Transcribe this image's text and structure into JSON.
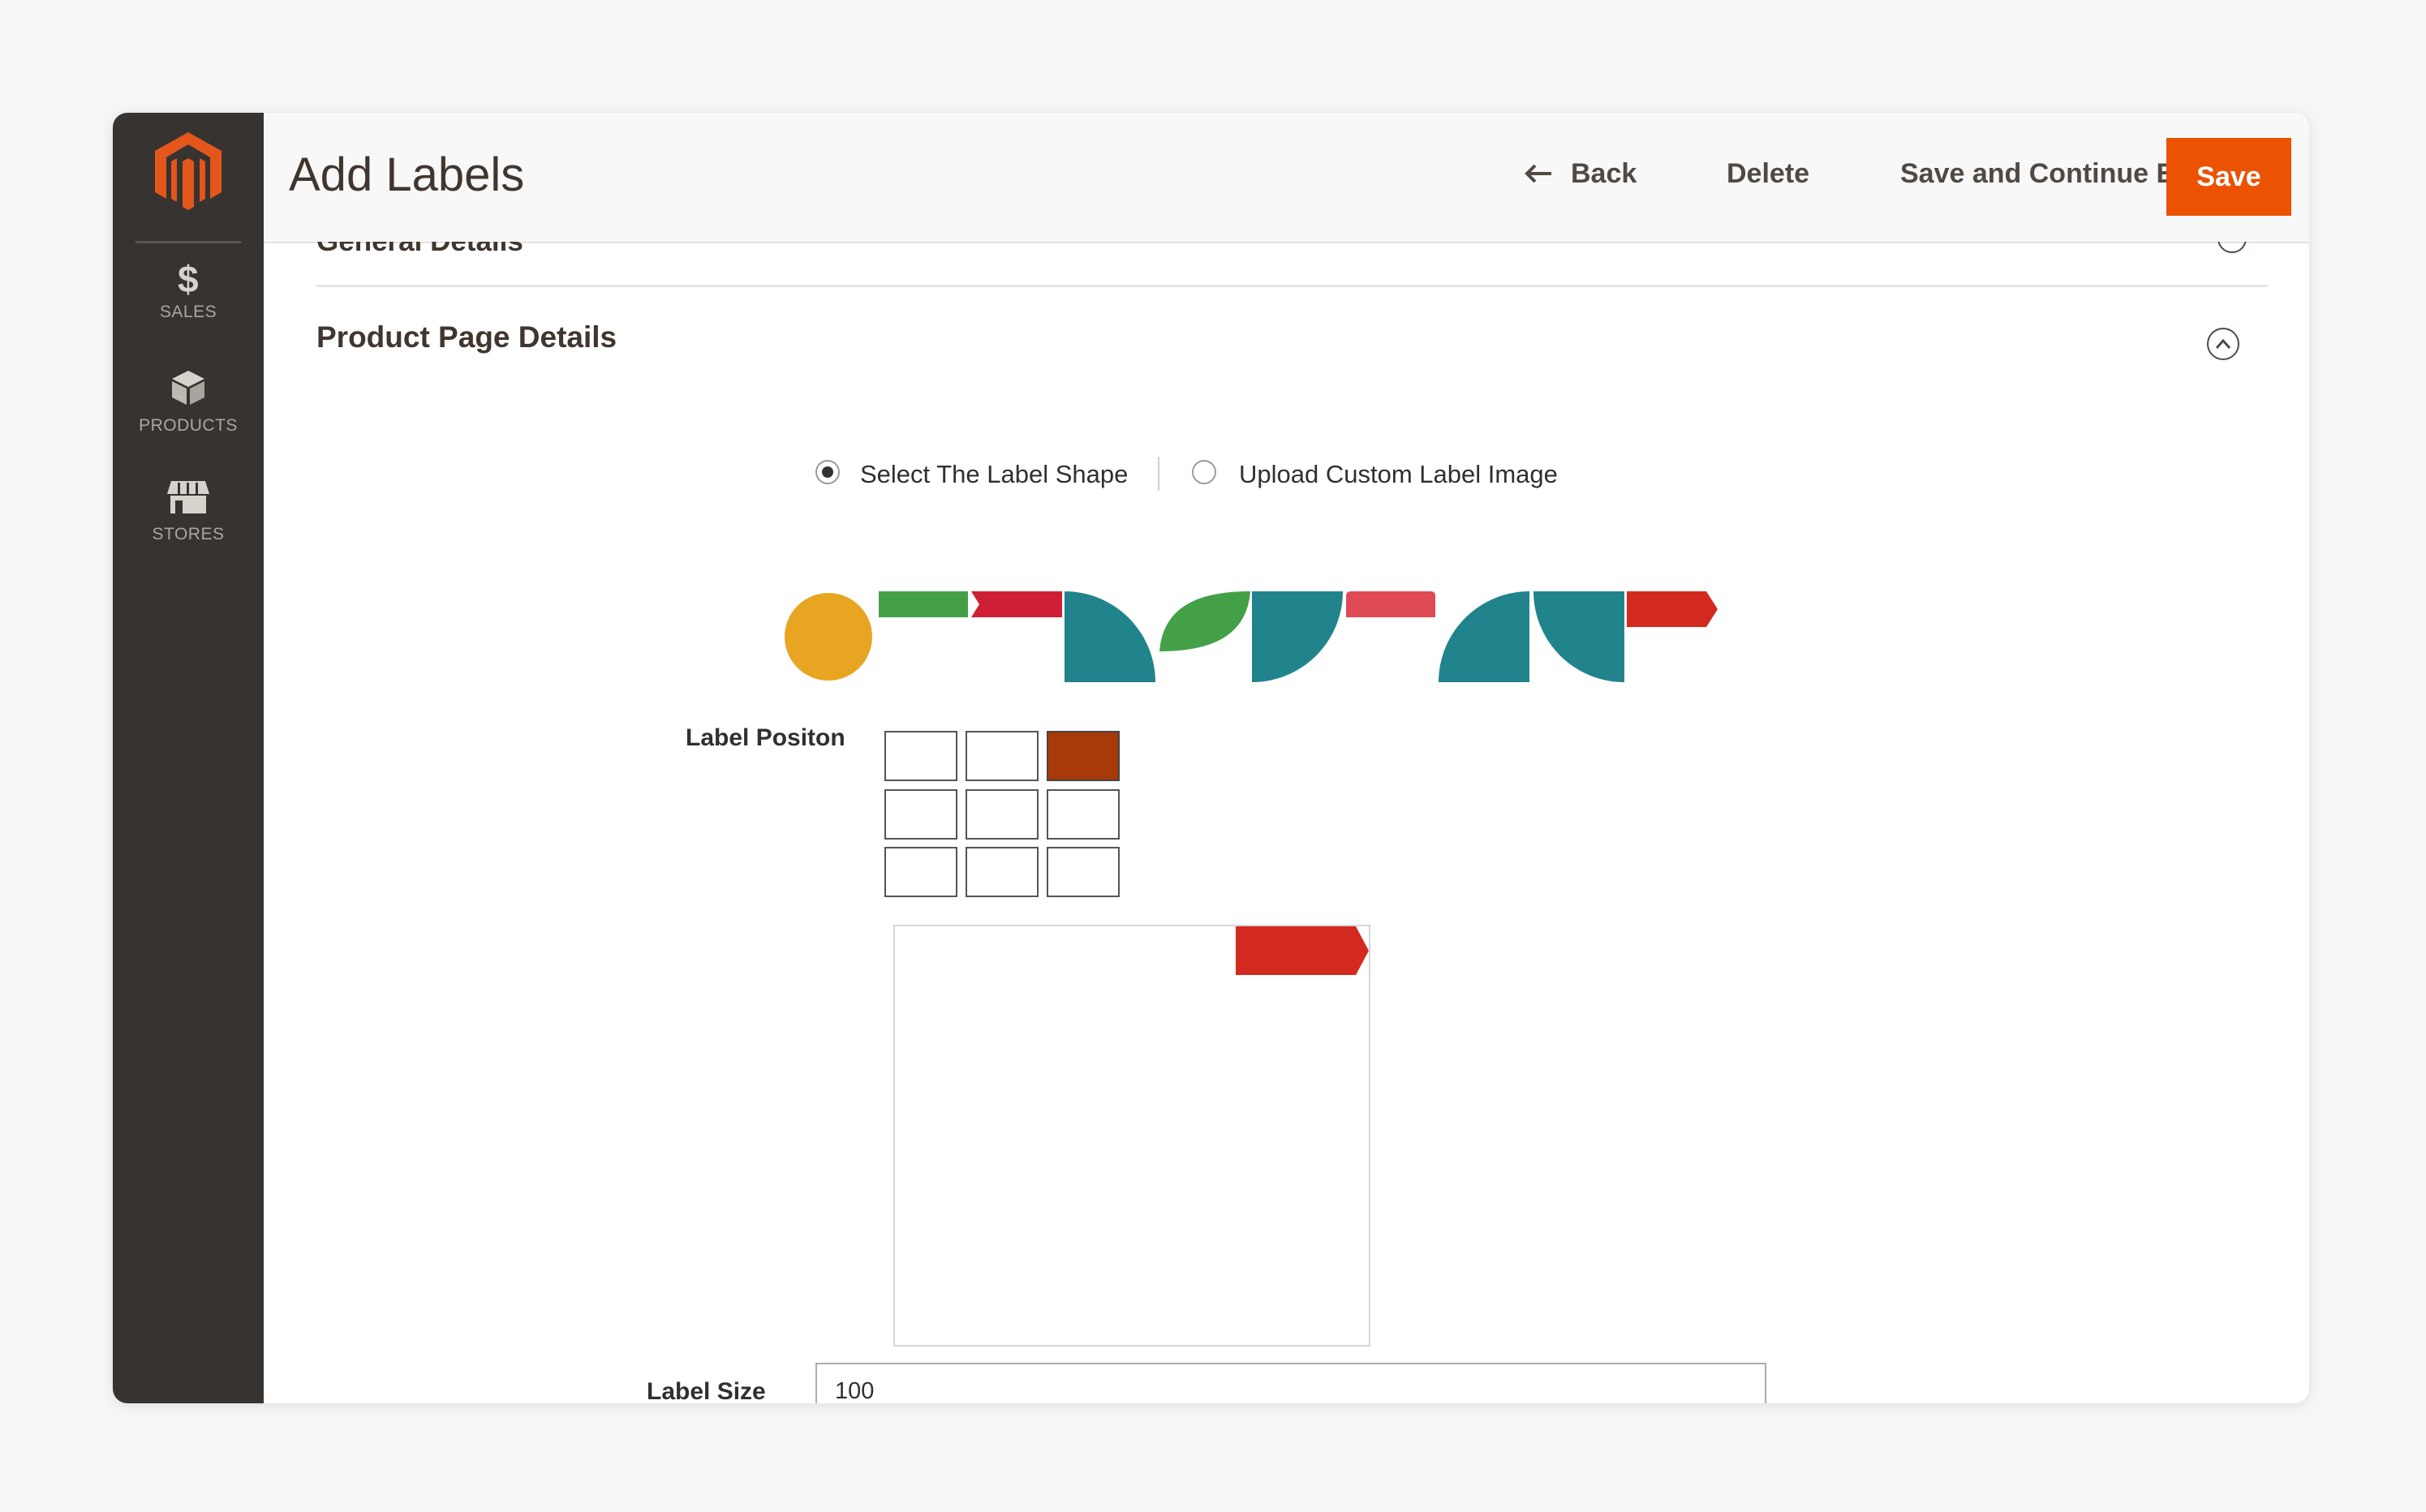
{
  "header": {
    "title": "Add Labels",
    "back_label": "Back",
    "delete_label": "Delete",
    "save_continue_label": "Save and Continue Edit",
    "save_label": "Save"
  },
  "sidebar": {
    "items": [
      {
        "label": "SALES",
        "icon": "dollar-icon"
      },
      {
        "label": "PRODUCTS",
        "icon": "box-icon"
      },
      {
        "label": "STORES",
        "icon": "store-icon"
      }
    ]
  },
  "sections": {
    "general_title": "General Details",
    "product_page_title": "Product Page Details"
  },
  "label_source": {
    "option_shape": "Select The Label Shape",
    "option_upload": "Upload Custom Label Image",
    "selected": "option_shape"
  },
  "label_shapes": [
    {
      "name": "circle",
      "color": "#e8a521"
    },
    {
      "name": "rectangle",
      "color": "#44a047"
    },
    {
      "name": "notched-ribbon",
      "color": "#cf1f36"
    },
    {
      "name": "quarter-circle-left",
      "color": "#21848d"
    },
    {
      "name": "leaf",
      "color": "#44a047"
    },
    {
      "name": "quarter-circle-right",
      "color": "#21848d"
    },
    {
      "name": "tab",
      "color": "#e04a55"
    },
    {
      "name": "quarter-circle-bottom",
      "color": "#21848d"
    },
    {
      "name": "quarter-circle-top",
      "color": "#21848d"
    },
    {
      "name": "arrow-tag",
      "color": "#d22a1f"
    }
  ],
  "label_position": {
    "label": "Label Positon",
    "selected_cell": "top-right",
    "active_color": "#a73a08"
  },
  "preview": {
    "tag_color": "#d22a1f"
  },
  "label_size": {
    "label": "Label Size",
    "value": "100"
  },
  "colors": {
    "accent": "#eb5202",
    "sidebar": "#373330"
  }
}
